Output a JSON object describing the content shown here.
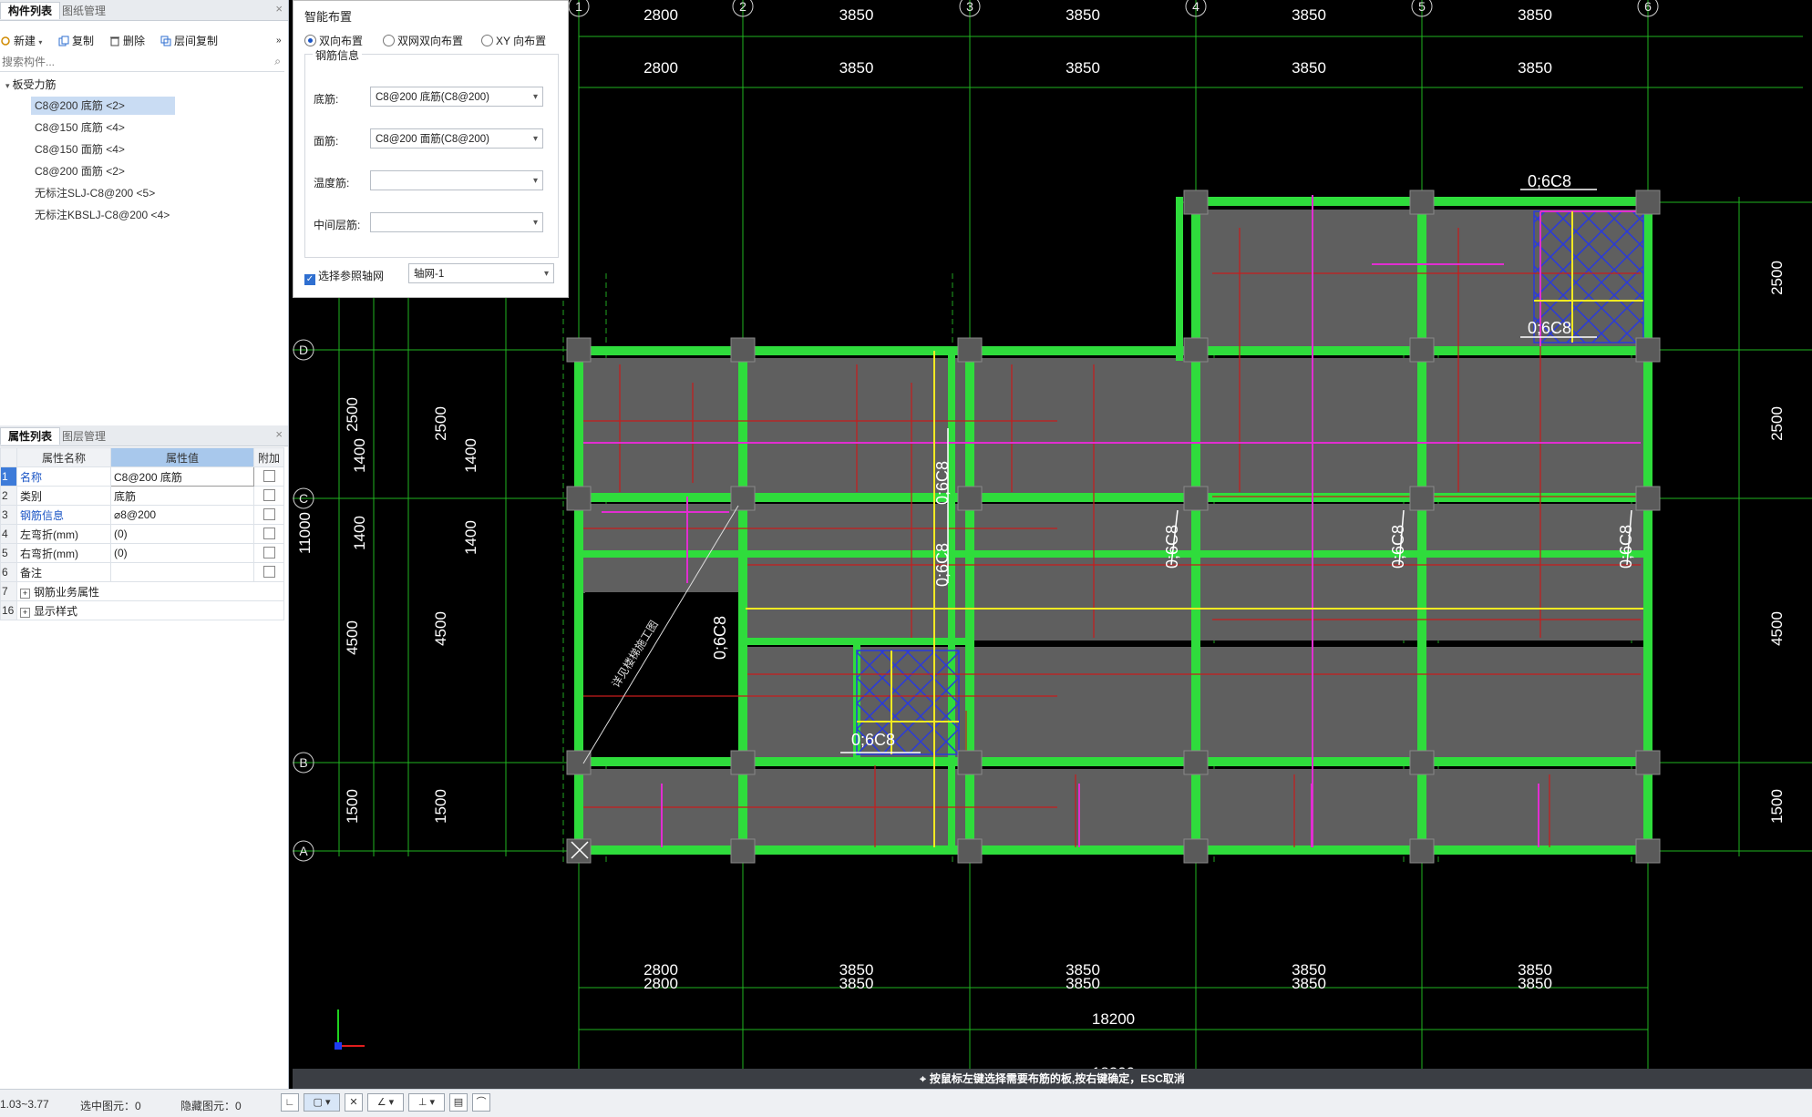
{
  "component_panel": {
    "tabs": [
      "构件列表",
      "图纸管理"
    ],
    "toolbar": {
      "new": "新建",
      "copy": "复制",
      "delete": "删除",
      "floor_copy": "层间复制"
    },
    "search_placeholder": "搜索构件...",
    "tree_root": "板受力筋",
    "items": [
      {
        "label": "C8@200 底筋 <2>"
      },
      {
        "label": "C8@150 底筋 <4>"
      },
      {
        "label": "C8@150 面筋 <4>"
      },
      {
        "label": "C8@200 面筋 <2>"
      },
      {
        "label": "无标注SLJ-C8@200 <5>"
      },
      {
        "label": "无标注KBSLJ-C8@200 <4>"
      }
    ]
  },
  "property_panel": {
    "tabs": [
      "属性列表",
      "图层管理"
    ],
    "headers": [
      "属性名称",
      "属性值",
      "附加"
    ],
    "rows": [
      {
        "num": "1",
        "name": "名称",
        "value": "C8@200 底筋"
      },
      {
        "num": "2",
        "name": "类别",
        "value": "底筋"
      },
      {
        "num": "3",
        "name": "钢筋信息",
        "value": "⌀8@200"
      },
      {
        "num": "4",
        "name": "左弯折(mm)",
        "value": "(0)"
      },
      {
        "num": "5",
        "name": "右弯折(mm)",
        "value": "(0)"
      },
      {
        "num": "6",
        "name": "备注",
        "value": ""
      },
      {
        "num": "7",
        "name": "钢筋业务属性",
        "value": ""
      },
      {
        "num": "16",
        "name": "显示样式",
        "value": ""
      }
    ]
  },
  "dialog": {
    "title": "智能布置",
    "radios": [
      "双向布置",
      "双网双向布置",
      "XY 向布置"
    ],
    "group_title": "钢筋信息",
    "fields": [
      {
        "label": "底筋:",
        "value": "C8@200 底筋(C8@200)"
      },
      {
        "label": "面筋:",
        "value": "C8@200 面筋(C8@200)"
      },
      {
        "label": "温度筋:",
        "value": ""
      },
      {
        "label": "中间层筋:",
        "value": ""
      }
    ],
    "ref_axis_label": "选择参照轴网",
    "ref_axis_value": "轴网-1"
  },
  "drawing": {
    "axis_cols": [
      "1",
      "2",
      "3",
      "4",
      "5",
      "6"
    ],
    "axis_rows": [
      "A",
      "B",
      "C",
      "D"
    ],
    "span_labels": [
      "2800",
      "3850",
      "3850",
      "3850",
      "3850"
    ],
    "total_width": "18200",
    "left_dims": [
      "1500",
      "4500",
      "1400",
      "1400",
      "2500",
      "11000"
    ],
    "left_dims_outer": [
      "1500",
      "4500",
      "2500"
    ],
    "right_dims": [
      "2500",
      "2500",
      "4500",
      "1500"
    ],
    "rebar_tags": [
      "0;6C8",
      "0;6C8",
      "0;6C8",
      "0;6C8",
      "0;6C8",
      "0;6C8",
      "0;6C8",
      "0;6C8",
      "0;6C8"
    ],
    "void_label": "详见楼梯施工图",
    "colors": {
      "beam": "#2fdc3c",
      "slab": "#5f5f5f",
      "axis": "#1fb51f",
      "bottom_rebar": "#c81c1c",
      "top_rebar": "#e12ed1",
      "yellow_rebar": "#f3ea22",
      "hatch": "#2a3adc"
    }
  },
  "message": "按鼠标左键选择需要布筋的板,按右键确定，ESC取消",
  "status": {
    "coords": "1.03~3.77",
    "selected": "选中图元：0",
    "hidden": "隐藏图元：0"
  }
}
